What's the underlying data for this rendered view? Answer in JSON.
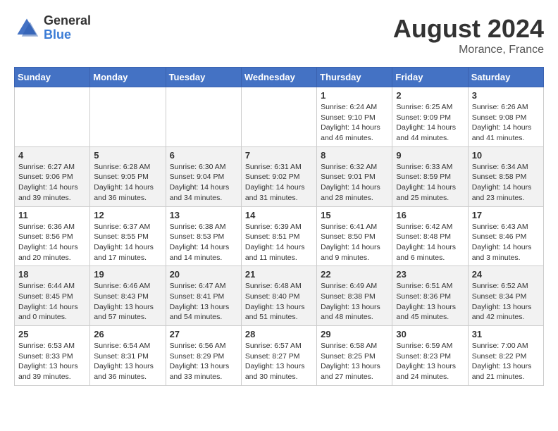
{
  "header": {
    "logo_general": "General",
    "logo_blue": "Blue",
    "month_year": "August 2024",
    "location": "Morance, France"
  },
  "days_of_week": [
    "Sunday",
    "Monday",
    "Tuesday",
    "Wednesday",
    "Thursday",
    "Friday",
    "Saturday"
  ],
  "weeks": [
    [
      {
        "day": "",
        "info": ""
      },
      {
        "day": "",
        "info": ""
      },
      {
        "day": "",
        "info": ""
      },
      {
        "day": "",
        "info": ""
      },
      {
        "day": "1",
        "info": "Sunrise: 6:24 AM\nSunset: 9:10 PM\nDaylight: 14 hours and 46 minutes."
      },
      {
        "day": "2",
        "info": "Sunrise: 6:25 AM\nSunset: 9:09 PM\nDaylight: 14 hours and 44 minutes."
      },
      {
        "day": "3",
        "info": "Sunrise: 6:26 AM\nSunset: 9:08 PM\nDaylight: 14 hours and 41 minutes."
      }
    ],
    [
      {
        "day": "4",
        "info": "Sunrise: 6:27 AM\nSunset: 9:06 PM\nDaylight: 14 hours and 39 minutes."
      },
      {
        "day": "5",
        "info": "Sunrise: 6:28 AM\nSunset: 9:05 PM\nDaylight: 14 hours and 36 minutes."
      },
      {
        "day": "6",
        "info": "Sunrise: 6:30 AM\nSunset: 9:04 PM\nDaylight: 14 hours and 34 minutes."
      },
      {
        "day": "7",
        "info": "Sunrise: 6:31 AM\nSunset: 9:02 PM\nDaylight: 14 hours and 31 minutes."
      },
      {
        "day": "8",
        "info": "Sunrise: 6:32 AM\nSunset: 9:01 PM\nDaylight: 14 hours and 28 minutes."
      },
      {
        "day": "9",
        "info": "Sunrise: 6:33 AM\nSunset: 8:59 PM\nDaylight: 14 hours and 25 minutes."
      },
      {
        "day": "10",
        "info": "Sunrise: 6:34 AM\nSunset: 8:58 PM\nDaylight: 14 hours and 23 minutes."
      }
    ],
    [
      {
        "day": "11",
        "info": "Sunrise: 6:36 AM\nSunset: 8:56 PM\nDaylight: 14 hours and 20 minutes."
      },
      {
        "day": "12",
        "info": "Sunrise: 6:37 AM\nSunset: 8:55 PM\nDaylight: 14 hours and 17 minutes."
      },
      {
        "day": "13",
        "info": "Sunrise: 6:38 AM\nSunset: 8:53 PM\nDaylight: 14 hours and 14 minutes."
      },
      {
        "day": "14",
        "info": "Sunrise: 6:39 AM\nSunset: 8:51 PM\nDaylight: 14 hours and 11 minutes."
      },
      {
        "day": "15",
        "info": "Sunrise: 6:41 AM\nSunset: 8:50 PM\nDaylight: 14 hours and 9 minutes."
      },
      {
        "day": "16",
        "info": "Sunrise: 6:42 AM\nSunset: 8:48 PM\nDaylight: 14 hours and 6 minutes."
      },
      {
        "day": "17",
        "info": "Sunrise: 6:43 AM\nSunset: 8:46 PM\nDaylight: 14 hours and 3 minutes."
      }
    ],
    [
      {
        "day": "18",
        "info": "Sunrise: 6:44 AM\nSunset: 8:45 PM\nDaylight: 14 hours and 0 minutes."
      },
      {
        "day": "19",
        "info": "Sunrise: 6:46 AM\nSunset: 8:43 PM\nDaylight: 13 hours and 57 minutes."
      },
      {
        "day": "20",
        "info": "Sunrise: 6:47 AM\nSunset: 8:41 PM\nDaylight: 13 hours and 54 minutes."
      },
      {
        "day": "21",
        "info": "Sunrise: 6:48 AM\nSunset: 8:40 PM\nDaylight: 13 hours and 51 minutes."
      },
      {
        "day": "22",
        "info": "Sunrise: 6:49 AM\nSunset: 8:38 PM\nDaylight: 13 hours and 48 minutes."
      },
      {
        "day": "23",
        "info": "Sunrise: 6:51 AM\nSunset: 8:36 PM\nDaylight: 13 hours and 45 minutes."
      },
      {
        "day": "24",
        "info": "Sunrise: 6:52 AM\nSunset: 8:34 PM\nDaylight: 13 hours and 42 minutes."
      }
    ],
    [
      {
        "day": "25",
        "info": "Sunrise: 6:53 AM\nSunset: 8:33 PM\nDaylight: 13 hours and 39 minutes."
      },
      {
        "day": "26",
        "info": "Sunrise: 6:54 AM\nSunset: 8:31 PM\nDaylight: 13 hours and 36 minutes."
      },
      {
        "day": "27",
        "info": "Sunrise: 6:56 AM\nSunset: 8:29 PM\nDaylight: 13 hours and 33 minutes."
      },
      {
        "day": "28",
        "info": "Sunrise: 6:57 AM\nSunset: 8:27 PM\nDaylight: 13 hours and 30 minutes."
      },
      {
        "day": "29",
        "info": "Sunrise: 6:58 AM\nSunset: 8:25 PM\nDaylight: 13 hours and 27 minutes."
      },
      {
        "day": "30",
        "info": "Sunrise: 6:59 AM\nSunset: 8:23 PM\nDaylight: 13 hours and 24 minutes."
      },
      {
        "day": "31",
        "info": "Sunrise: 7:00 AM\nSunset: 8:22 PM\nDaylight: 13 hours and 21 minutes."
      }
    ]
  ]
}
